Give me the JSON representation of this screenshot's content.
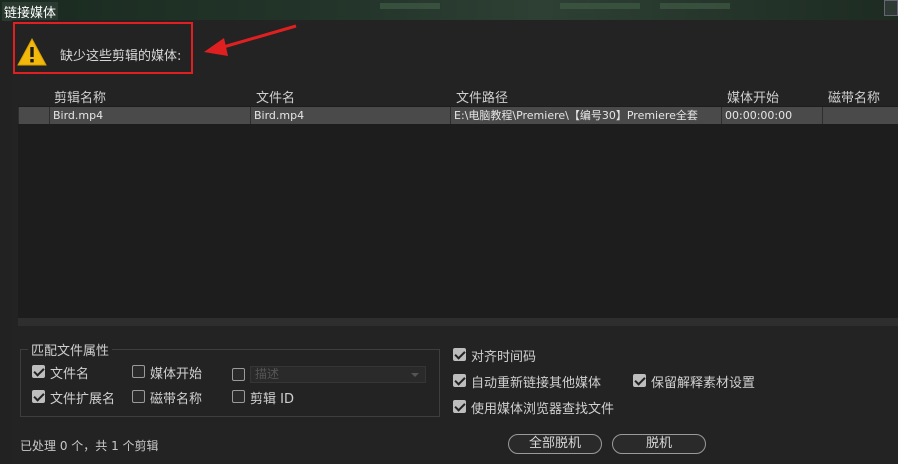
{
  "window": {
    "title": "链接媒体"
  },
  "warning": {
    "text": "缺少这些剪辑的媒体:"
  },
  "table": {
    "columns": [
      "剪辑名称",
      "文件名",
      "文件路径",
      "媒体开始",
      "磁带名称"
    ],
    "rows": [
      {
        "clip_name": "Bird.mp4",
        "file_name": "Bird.mp4",
        "file_path": "E:\\电脑教程\\Premiere\\【编号30】Premiere全套",
        "media_start": "00:00:00:00",
        "tape_name": ""
      }
    ]
  },
  "match_group": {
    "title": "匹配文件属性",
    "options": {
      "file_name": {
        "label": "文件名",
        "checked": true
      },
      "media_start": {
        "label": "媒体开始",
        "checked": false
      },
      "description": {
        "label": "",
        "checked": false
      },
      "file_ext": {
        "label": "文件扩展名",
        "checked": true
      },
      "tape_name": {
        "label": "磁带名称",
        "checked": false
      },
      "clip_id": {
        "label": "剪辑 ID",
        "checked": false
      }
    },
    "description_field": "描述"
  },
  "right_options": {
    "align_timecode": {
      "label": "对齐时间码",
      "checked": true
    },
    "auto_relink": {
      "label": "自动重新链接其他媒体",
      "checked": true
    },
    "preserve_interpret": {
      "label": "保留解释素材设置",
      "checked": true
    },
    "use_browser": {
      "label": "使用媒体浏览器查找文件",
      "checked": true
    }
  },
  "status": "已处理 0 个，共 1 个剪辑",
  "buttons": {
    "offline_all": "全部脱机",
    "offline": "脱机"
  },
  "colors": {
    "accent_red": "#e02020",
    "warning_yellow": "#f2b90c"
  }
}
